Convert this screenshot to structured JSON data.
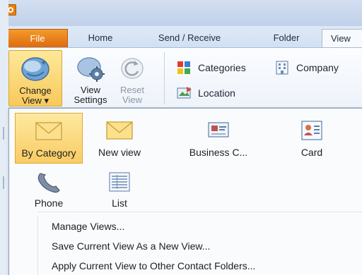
{
  "tabs": {
    "file": "File",
    "home": "Home",
    "send_receive": "Send / Receive",
    "folder": "Folder",
    "view": "View"
  },
  "ribbon": {
    "change_view": [
      "Change",
      "View ▾"
    ],
    "view_settings": [
      "View",
      "Settings"
    ],
    "reset_view": [
      "Reset",
      "View"
    ],
    "categories": "Categories",
    "company": "Company",
    "location": "Location"
  },
  "gallery": {
    "items": [
      {
        "label": "By Category",
        "icon": "envelope-icon",
        "selected": true
      },
      {
        "label": "New view",
        "icon": "envelope-icon",
        "selected": false
      },
      {
        "label": "Business C...",
        "icon": "business-card-icon",
        "selected": false
      },
      {
        "label": "Card",
        "icon": "contact-card-icon",
        "selected": false
      },
      {
        "label": "Phone",
        "icon": "phone-icon",
        "selected": false
      },
      {
        "label": "List",
        "icon": "list-icon",
        "selected": false
      }
    ]
  },
  "menu": {
    "manage_views": "Manage Views...",
    "save_view": "Save Current View As a New View...",
    "apply_view": "Apply Current View to Other Contact Folders..."
  },
  "colors": {
    "file_tab": "#e06a0d",
    "selected_highlight": "#f9cc64",
    "ribbon_bg": "#eef3fa"
  }
}
